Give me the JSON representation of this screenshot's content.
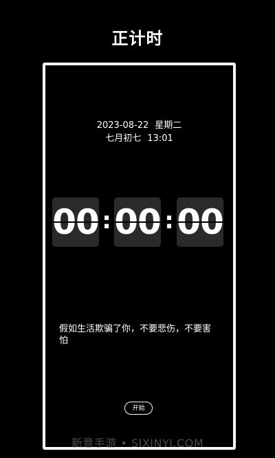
{
  "header": {
    "title": "正计时"
  },
  "datetime": {
    "date": "2023-08-22",
    "weekday": "星期二",
    "lunar_date": "七月初七",
    "time": "13:01"
  },
  "timer": {
    "hours": "00",
    "minutes": "00",
    "seconds": "00",
    "separator": ":"
  },
  "quote": {
    "text": "假如生活欺骗了你，不要悲伤，不要害怕"
  },
  "controls": {
    "start_label": "开始"
  },
  "watermark": {
    "text": "新意手游 • SIXINYI.COM"
  },
  "colors": {
    "background": "#000000",
    "foreground": "#ffffff",
    "card": "#2a2a2a"
  }
}
